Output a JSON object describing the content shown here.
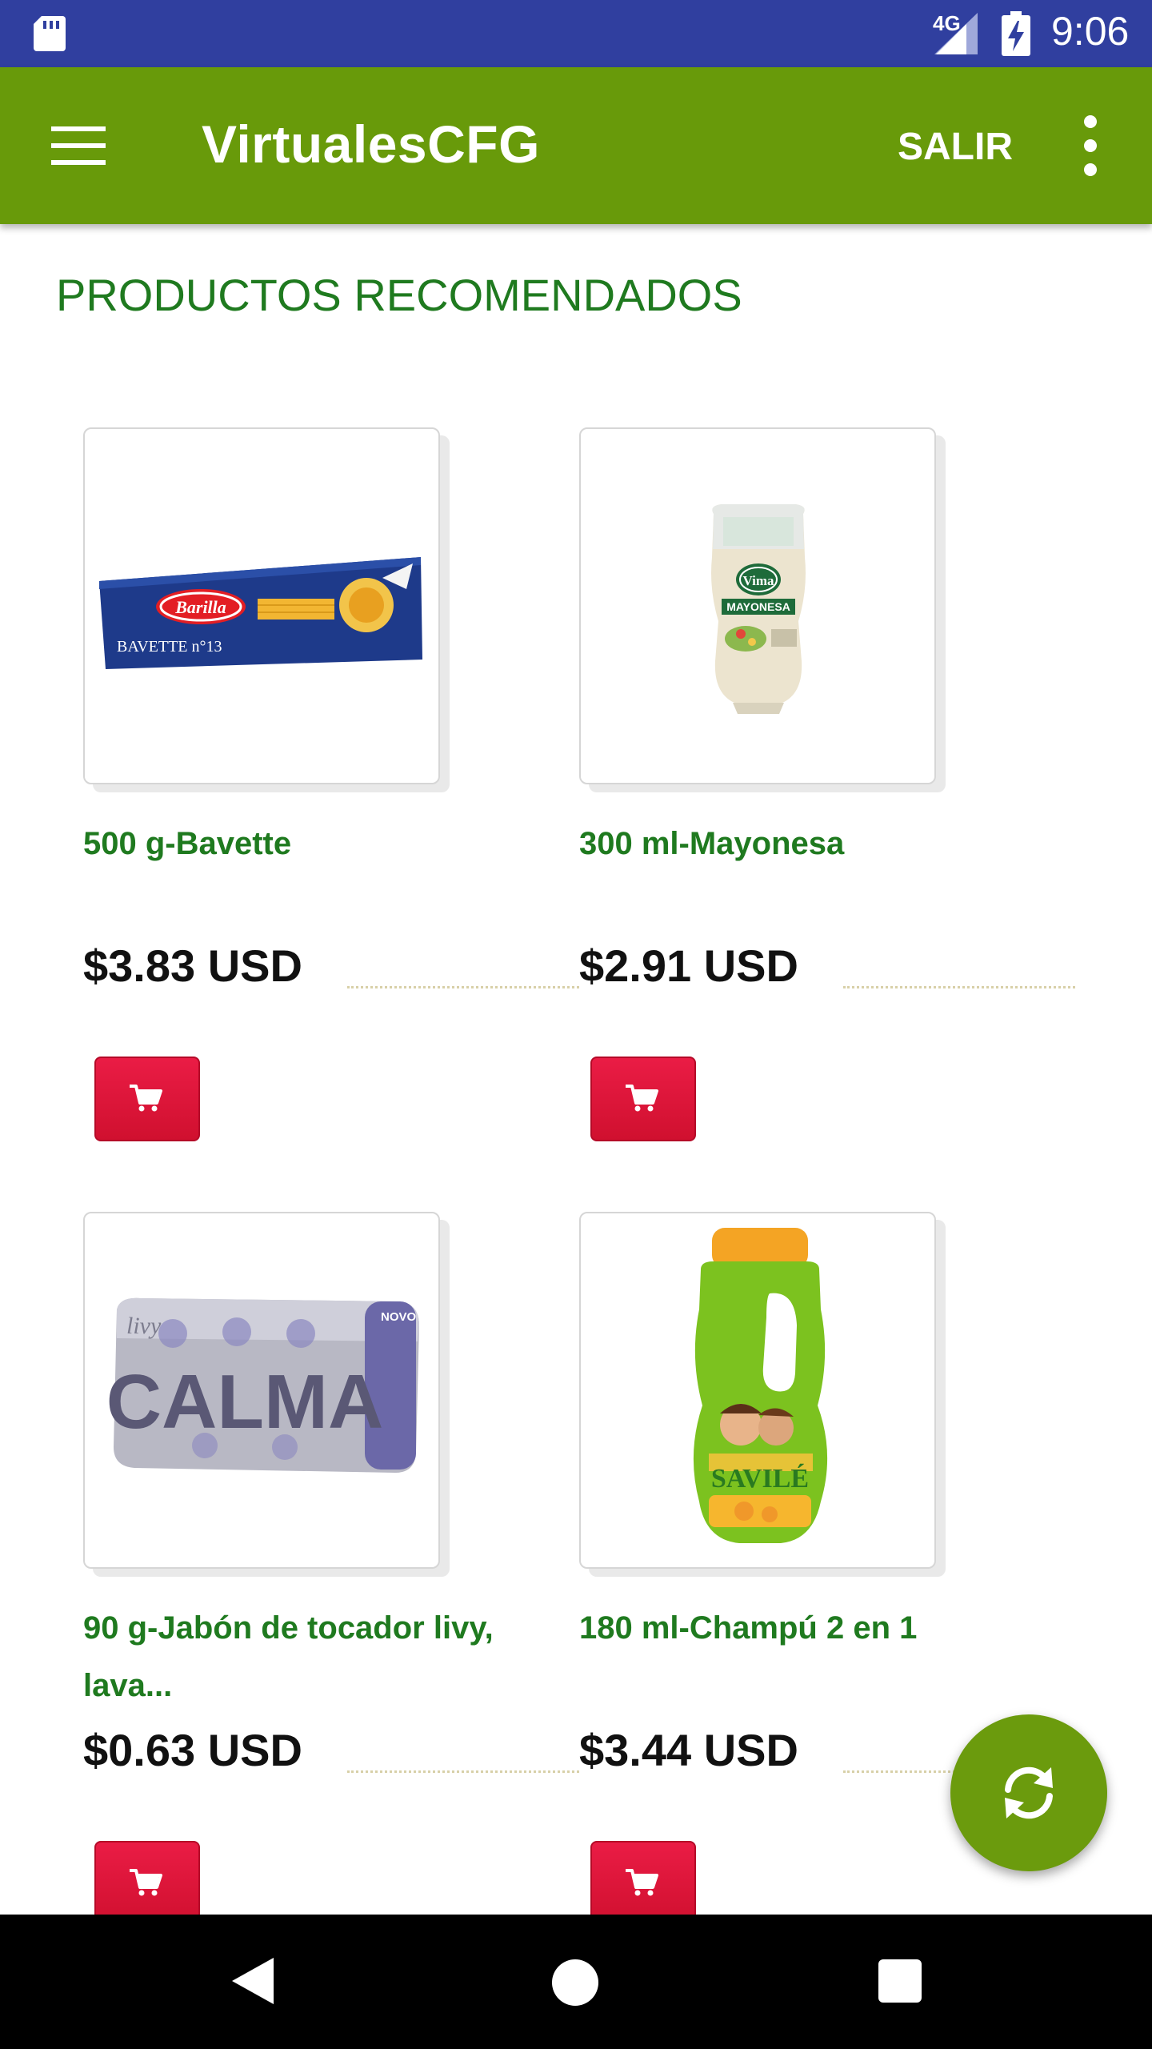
{
  "status_bar": {
    "network": "4G",
    "time": "9:06"
  },
  "app_bar": {
    "title": "VirtualesCFG",
    "logout_label": "SALIR"
  },
  "section": {
    "title": "PRODUCTOS RECOMENDADOS"
  },
  "products": [
    {
      "name": "500 g-Bavette",
      "price": "$3.83 USD",
      "image_icon": "pasta-box-icon"
    },
    {
      "name": "300 ml-Mayonesa",
      "price": "$2.91 USD",
      "image_icon": "mayonnaise-bottle-icon"
    },
    {
      "name": "90 g-Jabón de tocador livy, lava...",
      "price": "$0.63 USD",
      "image_icon": "soap-bar-icon"
    },
    {
      "name": "180 ml-Champú 2 en 1",
      "price": "$3.44 USD",
      "image_icon": "shampoo-bottle-icon"
    }
  ],
  "product_images": {
    "p1": {
      "brand": "Barilla",
      "label": "BAVETTE n°13"
    },
    "p2": {
      "brand": "Vima",
      "label": "MAYONESA"
    },
    "p3": {
      "brand": "livy",
      "label": "CALMA",
      "badge": "NOVO"
    },
    "p4": {
      "brand": "SAVILÉ"
    }
  },
  "colors": {
    "status_bar": "#303f9f",
    "app_bar": "#689a0a",
    "heading_green": "#1f7a1f",
    "cart_red": "#e0173c",
    "fab_green": "#6b9b0d"
  }
}
